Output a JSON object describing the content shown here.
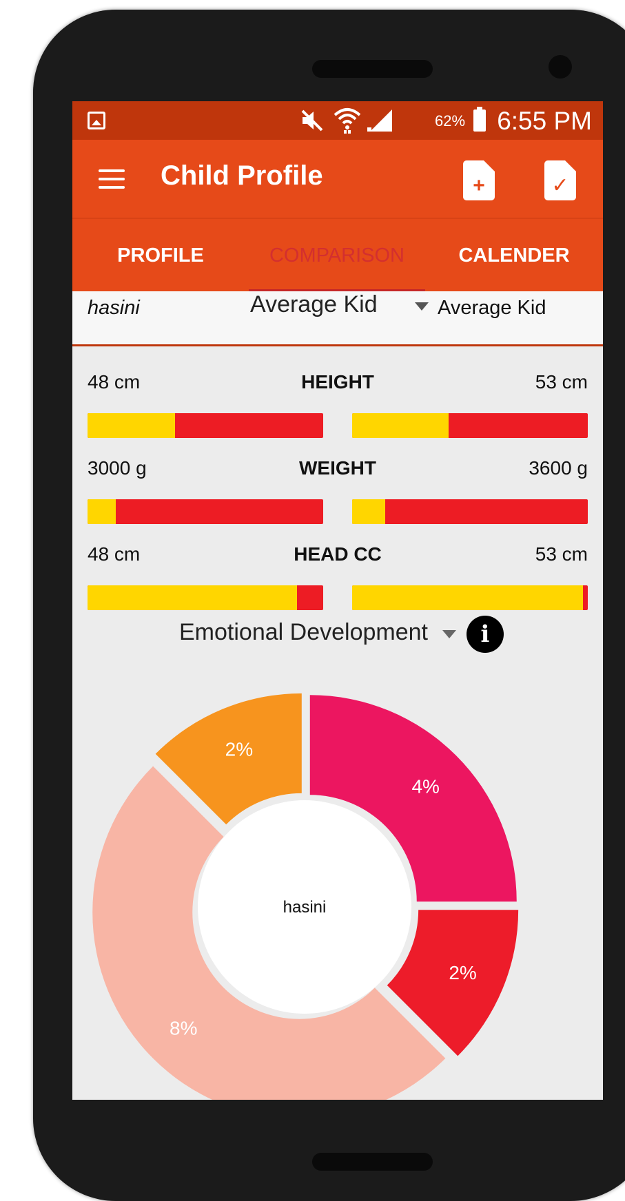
{
  "status_bar": {
    "battery": "62%",
    "time": "6:55 PM",
    "icons": [
      "image-icon",
      "mute-icon",
      "wifi-icon",
      "signal-icon",
      "battery-icon"
    ]
  },
  "toolbar": {
    "title": "Child Profile",
    "icons": [
      "menu-icon",
      "add-document-icon",
      "check-document-icon"
    ]
  },
  "tabs": [
    {
      "label": "PROFILE"
    },
    {
      "label": "COMPARISON"
    },
    {
      "label": "CALENDER"
    }
  ],
  "compare": {
    "left_name": "hasini",
    "middle_select": "Average Kid",
    "right_name": "Average Kid"
  },
  "metrics": [
    {
      "left": "48 cm",
      "title": "HEIGHT",
      "right": "53 cm",
      "left_fill": 0.37,
      "right_fill": 0.41
    },
    {
      "left": "3000 g",
      "title": "WEIGHT",
      "right": "3600 g",
      "left_fill": 0.12,
      "right_fill": 0.14
    },
    {
      "left": "48 cm",
      "title": "HEAD CC",
      "right": "53 cm",
      "left_fill": 0.89,
      "right_fill": 0.98
    }
  ],
  "emotional": {
    "label": "Emotional Development"
  },
  "colors": {
    "status_bar": "#bf360c",
    "toolbar": "#e64a19",
    "bar_fill": "#ffd600",
    "bar_track": "#ed1c24"
  },
  "chart_data": {
    "type": "pie",
    "center_label": "hasini",
    "slices": [
      {
        "label": "4%",
        "value": 4,
        "color": "#ec1660"
      },
      {
        "label": "2%",
        "value": 2,
        "color": "#ed1c2a"
      },
      {
        "label": "8%",
        "value": 8,
        "color": "#f8b5a5"
      },
      {
        "label": "2%",
        "value": 2,
        "color": "#f7941e"
      }
    ]
  }
}
